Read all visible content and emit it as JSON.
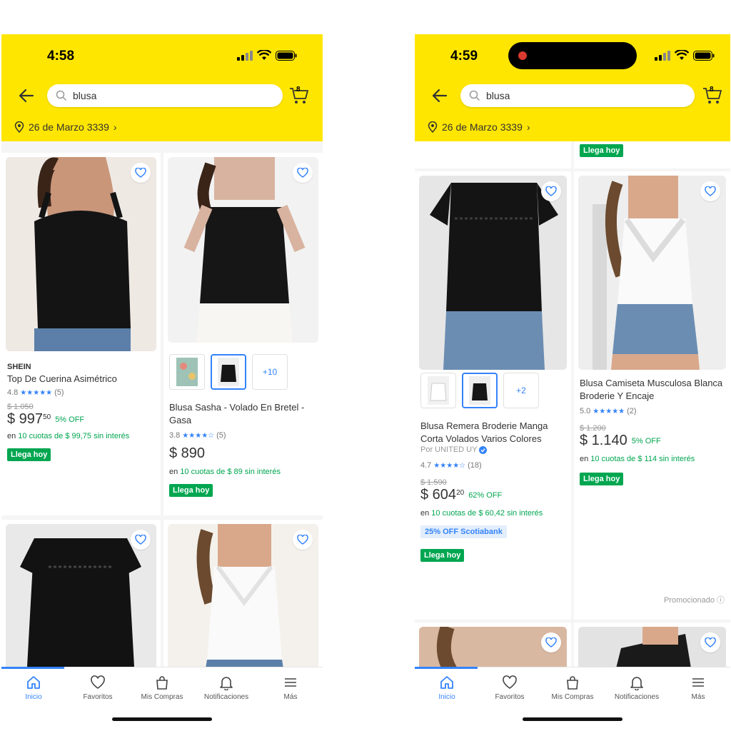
{
  "left": {
    "time": "4:58",
    "search": "blusa",
    "cart_count": "8",
    "address": "26 de Marzo 3339",
    "products": [
      {
        "brand": "SHEIN",
        "title": "Top De Cuerina Asimétrico",
        "rating": "4.8",
        "stars": "★★★★★",
        "reviews": "(5)",
        "old_price": "$ 1.050",
        "price": "$ 997",
        "cents": "50",
        "off": "5% OFF",
        "inst_pre": "en ",
        "inst_green": "10 cuotas de $ 99,75 sin interés",
        "delivery": "Llega hoy"
      },
      {
        "title": "Blusa Sasha - Volado En Bretel - Gasa",
        "rating": "3.8",
        "stars": "★★★★☆",
        "reviews": "(5)",
        "price": "$ 890",
        "inst_pre": "en ",
        "inst_green": "10 cuotas de $ 89 sin interés",
        "delivery": "Llega hoy",
        "more_colors": "+10"
      }
    ]
  },
  "right": {
    "time": "4:59",
    "search": "blusa",
    "cart_count": "8",
    "address": "26 de Marzo 3339",
    "top_delivery": "Llega hoy",
    "products": [
      {
        "title": "Blusa Remera Broderie Manga Corta Volados Varios Colores",
        "seller": "Por UNITED UY",
        "rating": "4.7",
        "stars": "★★★★☆",
        "reviews": "(18)",
        "old_price": "$ 1.590",
        "price": "$ 604",
        "cents": "20",
        "off": "62% OFF",
        "inst_pre": "en ",
        "inst_green": "10 cuotas de $ 60,42 sin interés",
        "promo_bank": "25% OFF Scotiabank",
        "delivery": "Llega hoy",
        "more_colors": "+2"
      },
      {
        "title": "Blusa Camiseta Musculosa Blanca Broderie Y Encaje",
        "rating": "5.0",
        "stars": "★★★★★",
        "reviews": "(2)",
        "old_price": "$ 1.200",
        "price": "$ 1.140",
        "off": "5% OFF",
        "inst_pre": "en ",
        "inst_green": "10 cuotas de $ 114 sin interés",
        "delivery": "Llega hoy"
      }
    ],
    "promoted": "Promocionado"
  },
  "tabs": [
    "Inicio",
    "Favoritos",
    "Mis Compras",
    "Notificaciones",
    "Más"
  ],
  "colors": {
    "header": "#ffe600",
    "accent": "#3483fa",
    "green": "#00a650"
  }
}
